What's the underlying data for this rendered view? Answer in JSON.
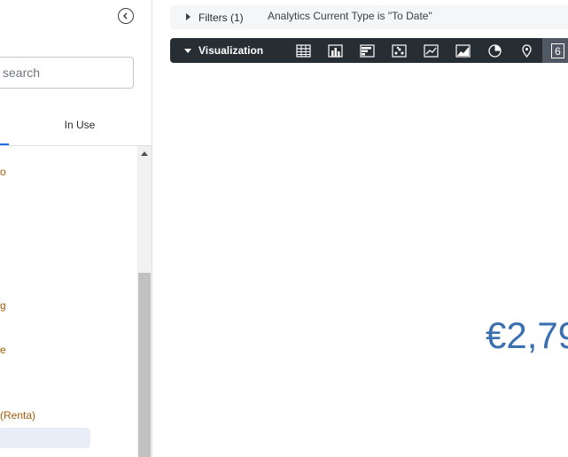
{
  "sidebar": {
    "search_placeholder": "search",
    "tabs": {
      "in_use_label": "In Use"
    },
    "fields": [
      {
        "label": "o"
      },
      {
        "label": "g"
      },
      {
        "label": "e"
      },
      {
        "label": "(Renta)"
      }
    ]
  },
  "filters": {
    "label": "Filters (1)",
    "summary": "Analytics Current Type is \"To Date\""
  },
  "visualization": {
    "label": "Visualization",
    "icons": [
      "table-icon",
      "column-chart-icon",
      "bar-chart-icon",
      "scatter-chart-icon",
      "line-chart-icon",
      "area-chart-icon",
      "pie-chart-icon",
      "map-pin-icon"
    ],
    "active_value": "6"
  },
  "single_value": {
    "text": "€2,79"
  },
  "colors": {
    "field_text": "#a55a0b",
    "value_text": "#3a6fb0",
    "viz_bar_bg": "#262d33",
    "active_tab": "#1f6fde"
  }
}
